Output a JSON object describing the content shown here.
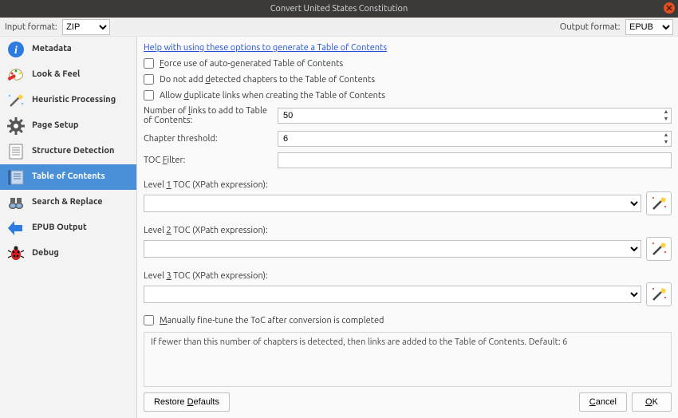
{
  "window": {
    "title": "Convert United States Constitution"
  },
  "top": {
    "input_label": "Input format:",
    "input_value": "ZIP",
    "output_label": "Output format:",
    "output_value": "EPUB"
  },
  "sidebar": {
    "items": [
      {
        "label": "Metadata"
      },
      {
        "label": "Look & Feel"
      },
      {
        "label": "Heuristic Processing"
      },
      {
        "label": "Page Setup"
      },
      {
        "label": "Structure Detection"
      },
      {
        "label": "Table of Contents"
      },
      {
        "label": "Search & Replace"
      },
      {
        "label": "EPUB Output"
      },
      {
        "label": "Debug"
      }
    ],
    "selected_index": 5
  },
  "main": {
    "help_link": "Help with using these options to generate a Table of Contents",
    "force": {
      "label_pre": "",
      "u": "F",
      "label_post": "orce use of auto-generated Table of Contents"
    },
    "donotadd": {
      "label_pre": "Do not add ",
      "u": "d",
      "label_post": "etected chapters to the Table of Contents"
    },
    "allowdup": {
      "label_pre": "Allow ",
      "u": "d",
      "label_post": "uplicate links when creating the Table of Contents"
    },
    "numlinks_lbl_pre": "Number of ",
    "numlinks_u": "l",
    "numlinks_lbl_post": "inks to add to Table of Contents:",
    "numlinks_value": "50",
    "chapthresh_lbl": "Chapter threshold:",
    "chapthresh_value": "6",
    "tocfilter_lbl_pre": "TOC ",
    "tocfilter_u": "F",
    "tocfilter_lbl_post": "ilter:",
    "tocfilter_value": "",
    "toc1_lbl_pre": "Level ",
    "toc1_u": "1",
    "toc1_lbl_post": " TOC (XPath expression):",
    "toc2_lbl_pre": "Level ",
    "toc2_u": "2",
    "toc2_lbl_post": " TOC (XPath expression):",
    "toc3_lbl_pre": "Level ",
    "toc3_u": "3",
    "toc3_lbl_post": " TOC (XPath expression):",
    "finetune_pre": "",
    "finetune_u": "M",
    "finetune_post": "anually fine-tune the ToC after conversion is completed",
    "hint": "If fewer than this number of chapters is detected, then links are added to the Table of Contents. Default: 6"
  },
  "buttons": {
    "restore_pre": "Restore ",
    "restore_u": "D",
    "restore_post": "efaults",
    "cancel_u": "C",
    "cancel_post": "ancel",
    "ok_u": "O",
    "ok_post": "K"
  }
}
